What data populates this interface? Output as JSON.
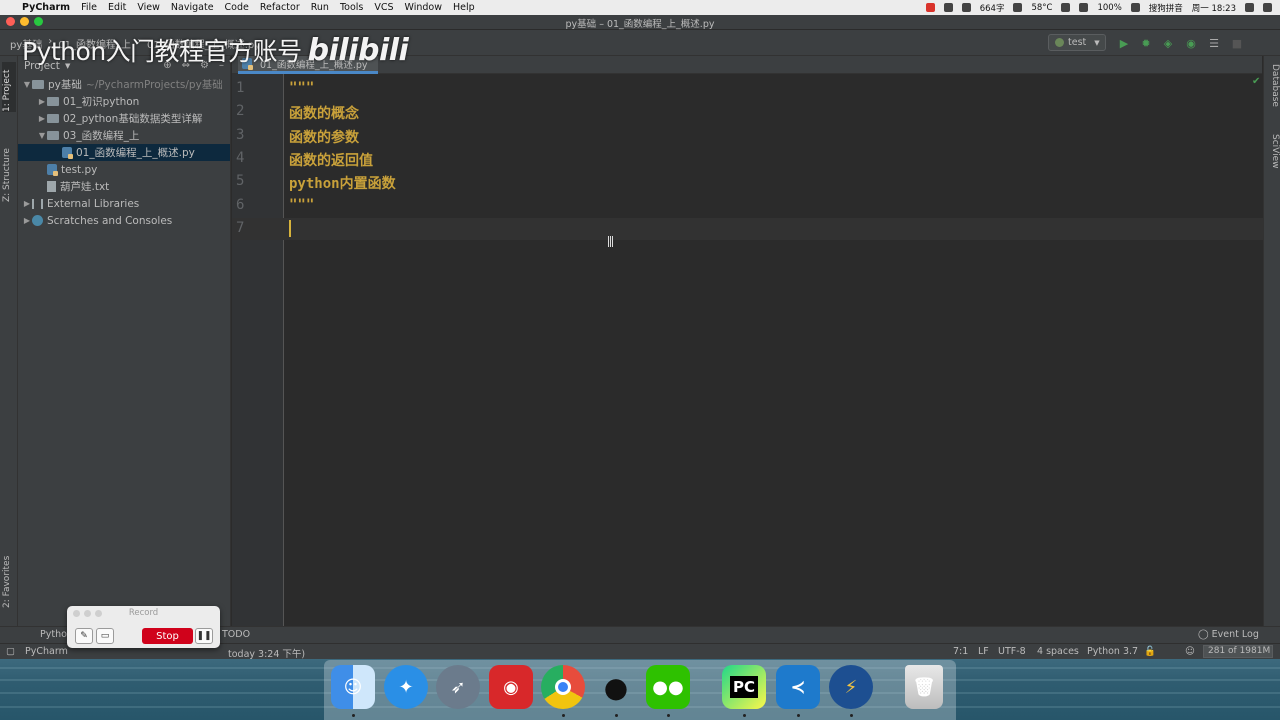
{
  "menubar": {
    "apple_glyph": "",
    "app": "PyCharm",
    "items": [
      "File",
      "Edit",
      "View",
      "Navigate",
      "Code",
      "Refactor",
      "Run",
      "Tools",
      "VCS",
      "Window",
      "Help"
    ],
    "word_count": "664字",
    "temp": "58°C",
    "battery": "100%",
    "ime": "搜狗拼音",
    "clock": "周一 18:23"
  },
  "window": {
    "title": "py基础 – 01_函数编程_上_概述.py"
  },
  "navbar": {
    "breadcrumb": [
      "py基础",
      "01_函数编程_上",
      "01_函数编程_上_概述.py"
    ],
    "run_config": "test"
  },
  "watermark": {
    "text": "Python入门教程官方账号",
    "brand": "bilibili"
  },
  "left_stripe": {
    "project_tab": "1: Project",
    "structure_tab": "Z: Structure",
    "favorites_tab": "2: Favorites"
  },
  "project_panel": {
    "title": "Project",
    "tree": [
      {
        "label": "py基础",
        "hint": "~/PycharmProjects/py基础",
        "kind": "folder",
        "arrow": "▼",
        "indent": 0
      },
      {
        "label": "01_初识python",
        "kind": "folder",
        "arrow": "▶",
        "indent": 1
      },
      {
        "label": "02_python基础数据类型详解",
        "kind": "folder",
        "arrow": "▶",
        "indent": 1
      },
      {
        "label": "03_函数编程_上",
        "kind": "folder",
        "arrow": "▼",
        "indent": 1
      },
      {
        "label": "01_函数编程_上_概述.py",
        "kind": "py",
        "arrow": "",
        "indent": 2,
        "selected": true
      },
      {
        "label": "test.py",
        "kind": "py",
        "arrow": "",
        "indent": 1
      },
      {
        "label": "葫芦娃.txt",
        "kind": "txt",
        "arrow": "",
        "indent": 1
      },
      {
        "label": "External Libraries",
        "kind": "lib",
        "arrow": "▶",
        "indent": 0
      },
      {
        "label": "Scratches and Consoles",
        "kind": "scratch",
        "arrow": "▶",
        "indent": 0
      }
    ]
  },
  "editor": {
    "tab_label": "01_函数编程_上_概述.py",
    "lines": [
      {
        "num": "1",
        "text": "\"\"\""
      },
      {
        "num": "2",
        "text": "函数的概念"
      },
      {
        "num": "3",
        "text": "函数的参数"
      },
      {
        "num": "4",
        "text": "函数的返回值"
      },
      {
        "num": "5",
        "text": "python内置函数"
      },
      {
        "num": "6",
        "text": "\"\"\""
      },
      {
        "num": "7",
        "text": ""
      }
    ]
  },
  "right_stripe": {
    "database_tab": "Database",
    "sciview_tab": "SciView"
  },
  "bottom_tools": {
    "python_console": "Python",
    "todo": "TODO",
    "event_log": "Event Log"
  },
  "status_bar": {
    "message_start": "PyCharm",
    "message_end": "today 3:24 下午)",
    "position": "7:1",
    "line_sep": "LF",
    "encoding": "UTF-8",
    "indent": "4 spaces",
    "interpreter": "Python 3.7",
    "memory": "281 of 1981M"
  },
  "record_widget": {
    "title": "Record",
    "stop_label": "Stop"
  },
  "dock": {
    "apps": [
      "Finder",
      "Safari",
      "Launchpad",
      "NetEase Music",
      "Chrome",
      "QQ",
      "WeChat",
      "PyCharm",
      "VS Code",
      "Instastats",
      "Trash"
    ],
    "pycharm_label": "PC"
  },
  "colors": {
    "editor_bg": "#2b2b2b",
    "string_color": "#c9a13a",
    "panel_bg": "#3c3f41",
    "selection": "#0d293e",
    "stop_red": "#d0021b"
  }
}
